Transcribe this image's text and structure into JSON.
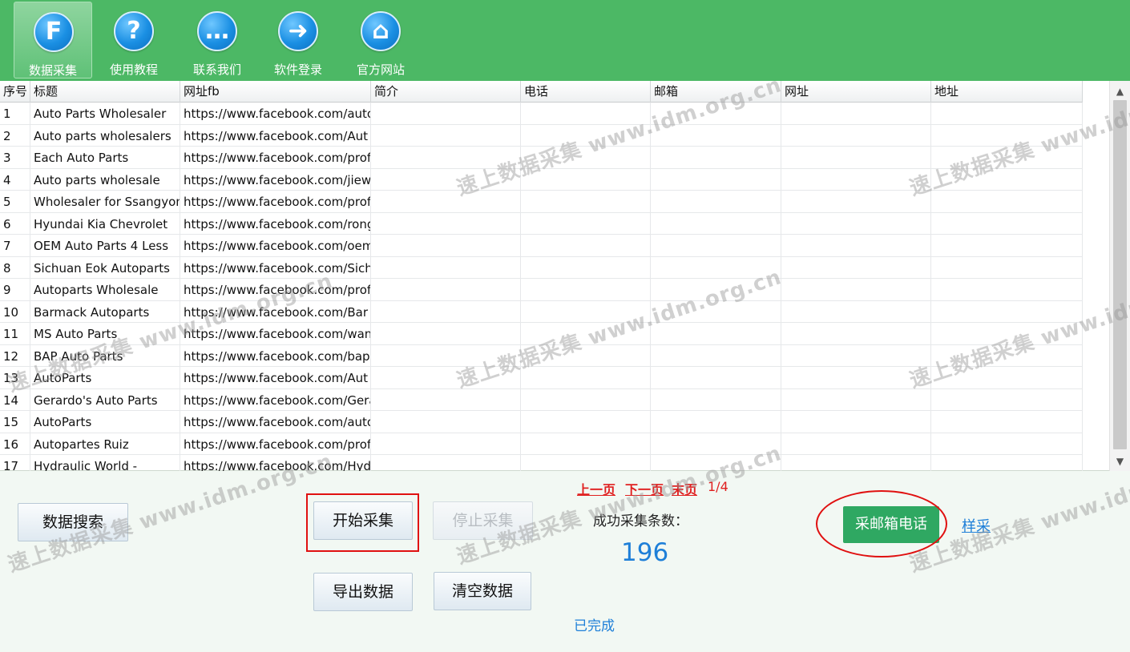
{
  "toolbar": {
    "items": [
      {
        "label": "数据采集",
        "glyph": "F"
      },
      {
        "label": "使用教程",
        "glyph": "?"
      },
      {
        "label": "联系我们",
        "glyph": "…"
      },
      {
        "label": "软件登录",
        "glyph": "➜"
      },
      {
        "label": "官方网站",
        "glyph": "⌂"
      }
    ]
  },
  "table": {
    "columns": [
      "序号",
      "标题",
      "网址fb",
      "简介",
      "电话",
      "邮箱",
      "网址",
      "地址"
    ],
    "rows": [
      [
        "1",
        "Auto Parts Wholesaler",
        "https://www.facebook.com/auto"
      ],
      [
        "2",
        "Auto parts wholesalers",
        "https://www.facebook.com/Aut"
      ],
      [
        "3",
        "Each Auto Parts",
        "https://www.facebook.com/profi"
      ],
      [
        "4",
        "Auto parts wholesale",
        "https://www.facebook.com/jiew"
      ],
      [
        "5",
        "Wholesaler for Ssangyong",
        "https://www.facebook.com/profi"
      ],
      [
        "6",
        "Hyundai Kia Chevrolet",
        "https://www.facebook.com/rong"
      ],
      [
        "7",
        "OEM Auto Parts 4 Less",
        "https://www.facebook.com/oem"
      ],
      [
        "8",
        "Sichuan Eok Autoparts",
        "https://www.facebook.com/Sich"
      ],
      [
        "9",
        "Autoparts Wholesale",
        "https://www.facebook.com/profi"
      ],
      [
        "10",
        "Barmack Autoparts",
        "https://www.facebook.com/Bar"
      ],
      [
        "11",
        "MS Auto Parts",
        "https://www.facebook.com/wan"
      ],
      [
        "12",
        "BAP Auto Parts",
        "https://www.facebook.com/bap"
      ],
      [
        "13",
        "AutoParts",
        "https://www.facebook.com/Aut"
      ],
      [
        "14",
        "Gerardo's Auto Parts",
        "https://www.facebook.com/Gera"
      ],
      [
        "15",
        "AutoParts",
        "https://www.facebook.com/auto"
      ],
      [
        "16",
        "Autopartes Ruiz",
        "https://www.facebook.com/profi"
      ],
      [
        "17",
        "Hydraulic World -",
        "https://www.facebook.com/Hydr"
      ]
    ]
  },
  "panel": {
    "search_btn": "数据搜索",
    "start_btn": "开始采集",
    "stop_btn": "停止采集",
    "export_btn": "导出数据",
    "clear_btn": "清空数据",
    "prev": "上一页",
    "next": "下一页",
    "last": "末页",
    "page": "1/4",
    "count_label": "成功采集条数：",
    "count": "196",
    "status": "已完成",
    "email_phone_btn": "采邮箱电话",
    "sample_link": "样采"
  },
  "watermark": {
    "brand": "速上数据采集",
    "url": "www.idm.org.cn"
  },
  "colors": {
    "toolbar": "#4cb865",
    "accent_blue": "#1e7fd8",
    "highlight_red": "#e01010",
    "green_button": "#2fa862"
  }
}
